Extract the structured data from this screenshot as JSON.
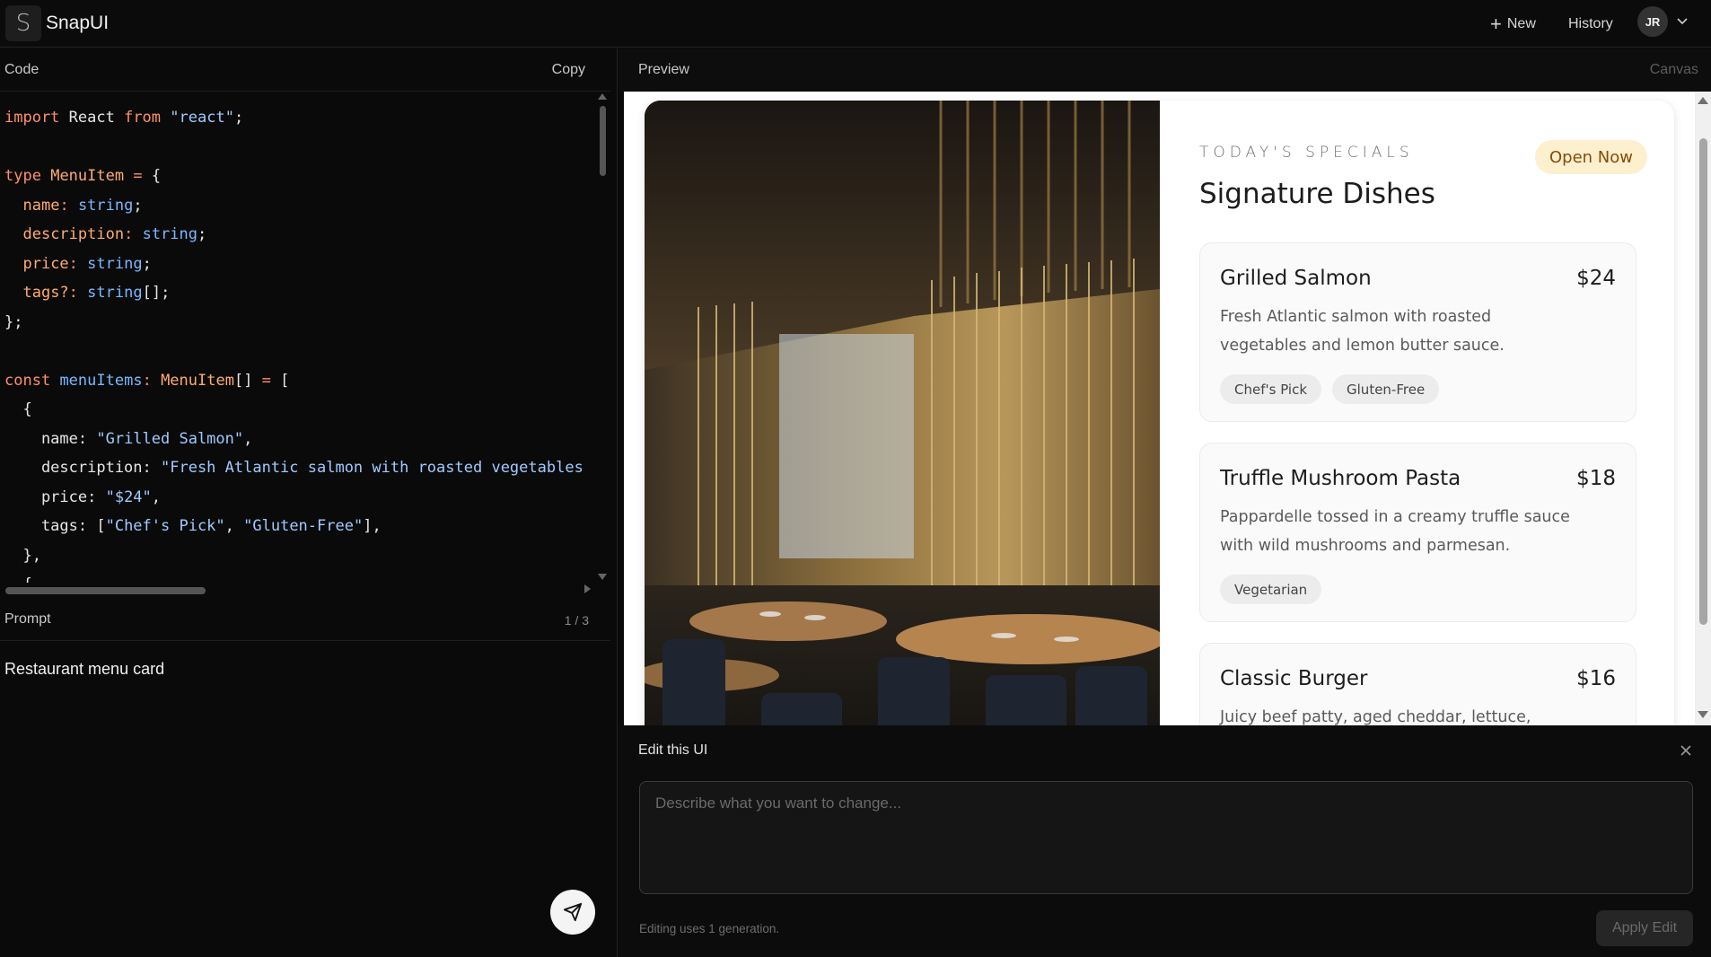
{
  "app": {
    "logo_letter": "S",
    "brand": "SnapUI",
    "new_label": "New",
    "history_label": "History",
    "avatar_initials": "JR"
  },
  "code_panel": {
    "title": "Code",
    "copy_label": "Copy",
    "lines": [
      [
        {
          "t": "import",
          "c": "kw"
        },
        {
          "t": " React "
        },
        {
          "t": "from",
          "c": "kw"
        },
        {
          "t": " "
        },
        {
          "t": "\"react\"",
          "c": "str"
        },
        {
          "t": ";"
        }
      ],
      [],
      [
        {
          "t": "type",
          "c": "kw"
        },
        {
          "t": " "
        },
        {
          "t": "MenuItem",
          "c": "type"
        },
        {
          "t": " "
        },
        {
          "t": "=",
          "c": "kw"
        },
        {
          "t": " {"
        }
      ],
      [
        {
          "t": "  "
        },
        {
          "t": "name",
          "c": "prop"
        },
        {
          "t": ":",
          "c": "kw"
        },
        {
          "t": " "
        },
        {
          "t": "string",
          "c": "tp"
        },
        {
          "t": ";"
        }
      ],
      [
        {
          "t": "  "
        },
        {
          "t": "description",
          "c": "prop"
        },
        {
          "t": ":",
          "c": "kw"
        },
        {
          "t": " "
        },
        {
          "t": "string",
          "c": "tp"
        },
        {
          "t": ";"
        }
      ],
      [
        {
          "t": "  "
        },
        {
          "t": "price",
          "c": "prop"
        },
        {
          "t": ":",
          "c": "kw"
        },
        {
          "t": " "
        },
        {
          "t": "string",
          "c": "tp"
        },
        {
          "t": ";"
        }
      ],
      [
        {
          "t": "  "
        },
        {
          "t": "tags?",
          "c": "prop"
        },
        {
          "t": ":",
          "c": "kw"
        },
        {
          "t": " "
        },
        {
          "t": "string",
          "c": "tp"
        },
        {
          "t": "[];"
        }
      ],
      [
        {
          "t": "};"
        }
      ],
      [],
      [
        {
          "t": "const",
          "c": "kw"
        },
        {
          "t": " "
        },
        {
          "t": "menuItems",
          "c": "tp"
        },
        {
          "t": ":",
          "c": "kw"
        },
        {
          "t": " "
        },
        {
          "t": "MenuItem",
          "c": "type"
        },
        {
          "t": "[] "
        },
        {
          "t": "=",
          "c": "kw"
        },
        {
          "t": " ["
        }
      ],
      [
        {
          "t": "  {"
        }
      ],
      [
        {
          "t": "    name: "
        },
        {
          "t": "\"Grilled Salmon\"",
          "c": "str"
        },
        {
          "t": ","
        }
      ],
      [
        {
          "t": "    description: "
        },
        {
          "t": "\"Fresh Atlantic salmon with roasted vegetables",
          "c": "str"
        }
      ],
      [
        {
          "t": "    price: "
        },
        {
          "t": "\"$24\"",
          "c": "str"
        },
        {
          "t": ","
        }
      ],
      [
        {
          "t": "    tags: ["
        },
        {
          "t": "\"Chef's Pick\"",
          "c": "str"
        },
        {
          "t": ", "
        },
        {
          "t": "\"Gluten-Free\"",
          "c": "str"
        },
        {
          "t": "],"
        }
      ],
      [
        {
          "t": "  },"
        }
      ],
      [
        {
          "t": "  {"
        }
      ]
    ]
  },
  "prompt_panel": {
    "title": "Prompt",
    "counter": "1 / 3",
    "text": "Restaurant menu card"
  },
  "preview_panel": {
    "title": "Preview",
    "canvas_label": "Canvas"
  },
  "menu_card": {
    "eyebrow": "TODAY'S SPECIALS",
    "heading": "Signature Dishes",
    "badge": "Open Now",
    "dishes": [
      {
        "name": "Grilled Salmon",
        "price": "$24",
        "description": "Fresh Atlantic salmon with roasted vegetables and lemon butter sauce.",
        "tags": [
          "Chef's Pick",
          "Gluten-Free"
        ]
      },
      {
        "name": "Truffle Mushroom Pasta",
        "price": "$18",
        "description": "Pappardelle tossed in a creamy truffle sauce with wild mushrooms and parmesan.",
        "tags": [
          "Vegetarian"
        ]
      },
      {
        "name": "Classic Burger",
        "price": "$16",
        "description": "Juicy beef patty, aged cheddar, lettuce,",
        "tags": []
      }
    ]
  },
  "edit_panel": {
    "title": "Edit this UI",
    "placeholder": "Describe what you want to change...",
    "note": "Editing uses 1 generation.",
    "apply_label": "Apply Edit"
  },
  "colors": {
    "background": "#0a0a0a",
    "badge_bg": "#fdf0cf",
    "badge_text": "#8a4a05",
    "code_keyword": "#ff8f6b",
    "code_string": "#9ecbff"
  }
}
